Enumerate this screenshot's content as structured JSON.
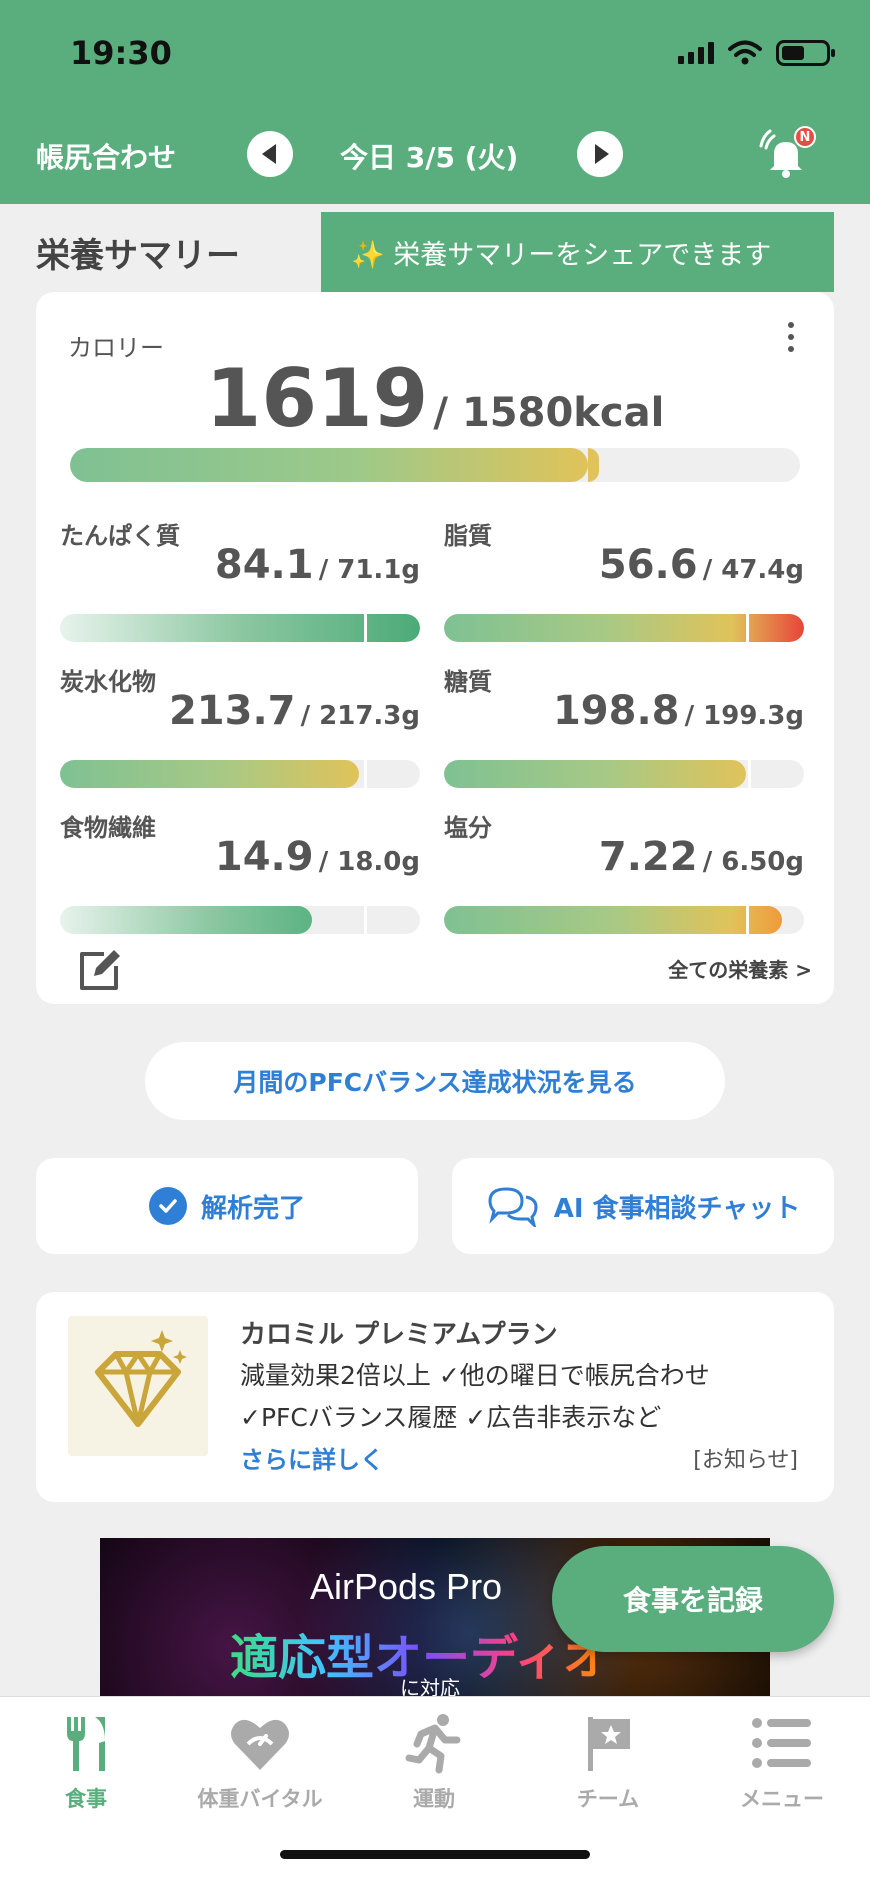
{
  "status": {
    "time": "19:30"
  },
  "header": {
    "left_label": "帳尻合わせ",
    "date": "今日 3/5 (火)",
    "notification_badge": "N",
    "bg_color": "#5aae7d"
  },
  "summary": {
    "section_title": "栄養サマリー",
    "share_tip": "✨ 栄養サマリーをシェアできます",
    "calorie": {
      "label": "カロリー",
      "value": "1619",
      "target": "/ 1580kcal",
      "progress": 1.02
    },
    "nutrients": [
      {
        "name": "たんぱく質",
        "value": "84.1",
        "target": "/ 71.1g",
        "progress": 1.18
      },
      {
        "name": "脂質",
        "value": "56.6",
        "target": "/ 47.4g",
        "progress": 1.19
      },
      {
        "name": "炭水化物",
        "value": "213.7",
        "target": "/ 217.3g",
        "progress": 0.98
      },
      {
        "name": "糖質",
        "value": "198.8",
        "target": "/ 199.3g",
        "progress": 0.997
      },
      {
        "name": "食物繊維",
        "value": "14.9",
        "target": "/ 18.0g",
        "progress": 0.83
      },
      {
        "name": "塩分",
        "value": "7.22",
        "target": "/ 6.50g",
        "progress": 1.11
      }
    ],
    "all_nutrients_link": "全ての栄養素 >"
  },
  "pfc_button": "月間のPFCバランス達成状況を見る",
  "actions": {
    "analysis_done": "解析完了",
    "ai_chat": "AI 食事相談チャット"
  },
  "premium": {
    "title": "カロミル プレミアムプラン",
    "line1": "減量効果2倍以上 ✓他の曜日で帳尻合わせ",
    "line2": "✓PFCバランス履歴 ✓広告非表示など",
    "more": "さらに詳しく",
    "tag": "[お知らせ]"
  },
  "ad": {
    "brand": "AirPods Pro",
    "headline": "適応型オーディオ",
    "sub": "に対応"
  },
  "fab": "食事を記録",
  "tabs": [
    {
      "label": "食事",
      "icon": "fork-knife-icon",
      "active": true
    },
    {
      "label": "体重バイタル",
      "icon": "heart-scale-icon",
      "active": false
    },
    {
      "label": "運動",
      "icon": "runner-icon",
      "active": false
    },
    {
      "label": "チーム",
      "icon": "flag-icon",
      "active": false
    },
    {
      "label": "メニュー",
      "icon": "menu-list-icon",
      "active": false
    }
  ]
}
